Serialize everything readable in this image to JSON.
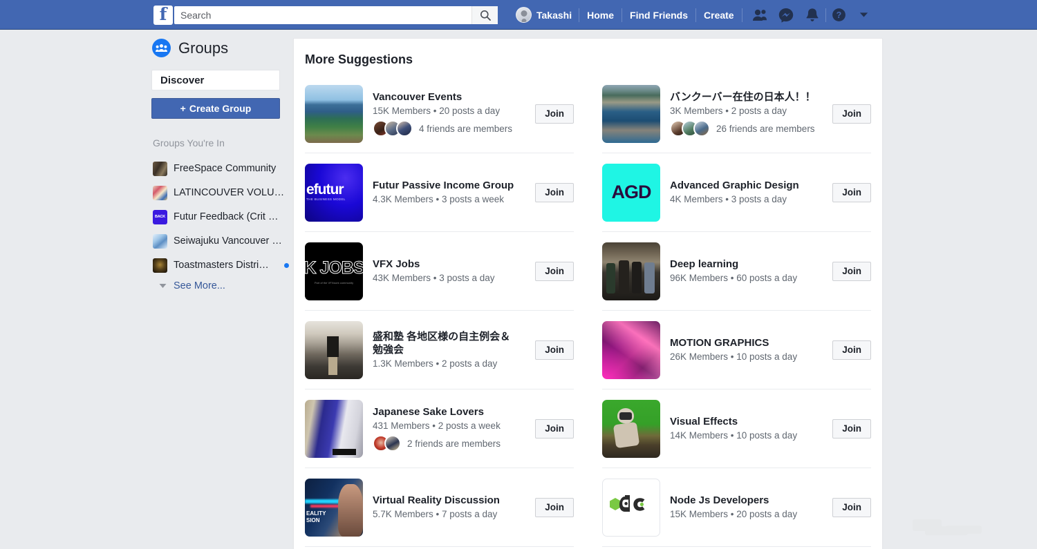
{
  "colors": {
    "header_blue": "#4267b2",
    "page_bg": "#e9ebee",
    "card_bg": "#ffffff",
    "link_blue": "#365899",
    "accent_blue": "#1877f2",
    "muted_text": "#606770",
    "label_gray": "#90949c"
  },
  "header": {
    "logo_text": "f",
    "search": {
      "placeholder": "Search",
      "value": ""
    },
    "user_name": "Takashi",
    "links": [
      "Home",
      "Find Friends",
      "Create"
    ],
    "icons": [
      "friend-requests-icon",
      "messenger-icon",
      "notifications-icon",
      "help-icon",
      "account-menu-caret-icon"
    ]
  },
  "sidebar": {
    "title": "Groups",
    "discover_label": "Discover",
    "create_group_label": "Create Group",
    "create_group_plus": "+",
    "section_label": "Groups You're In",
    "groups": [
      {
        "name": "FreeSpace Community",
        "unread": false
      },
      {
        "name": "LATINCOUVER VOLU…",
        "unread": false
      },
      {
        "name": "Futur Feedback (Crit …",
        "unread": false
      },
      {
        "name": "Seiwajuku Vancouver …",
        "unread": false
      },
      {
        "name": "Toastmasters Distri…",
        "unread": true
      }
    ],
    "see_more_label": "See More..."
  },
  "main": {
    "title": "More Suggestions",
    "join_label": "Join",
    "suggestions": [
      {
        "name": "Vancouver Events",
        "meta": "15K Members • 20 posts a day",
        "friends_text": "4 friends are members",
        "friend_faces": 3,
        "thumb": "vancouver-skyline"
      },
      {
        "name": "バンクーバー在住の日本人！！",
        "meta": "3K Members • 2 posts a day",
        "friends_text": "26 friends are members",
        "friend_faces": 3,
        "thumb": "vancouver-aerial"
      },
      {
        "name": "Futur Passive Income Group",
        "meta": "4.3K Members • 3 posts a week",
        "friends_text": "",
        "friend_faces": 0,
        "thumb": "futur-blue"
      },
      {
        "name": "Advanced Graphic Design",
        "meta": "4K Members • 3 posts a day",
        "friends_text": "",
        "friend_faces": 0,
        "thumb": "agd-cyan"
      },
      {
        "name": "VFX Jobs",
        "meta": "43K Members • 3 posts a day",
        "friends_text": "",
        "friend_faces": 0,
        "thumb": "vfx-jobs-black"
      },
      {
        "name": "Deep learning",
        "meta": "96K Members • 60 posts a day",
        "friends_text": "",
        "friend_faces": 0,
        "thumb": "deep-learning-photo"
      },
      {
        "name": "盛和塾 各地区様の自主例会＆勉強会",
        "meta": "1.3K Members • 2 posts a day",
        "friends_text": "",
        "friend_faces": 0,
        "thumb": "seiwajuku-hall"
      },
      {
        "name": "MOTION GRAPHICS",
        "meta": "26K Members • 10 posts a day",
        "friends_text": "",
        "friend_faces": 0,
        "thumb": "motion-graphics-magenta"
      },
      {
        "name": "Japanese Sake Lovers",
        "meta": "431 Members • 2 posts a week",
        "friends_text": "2 friends are members",
        "friend_faces": 2,
        "thumb": "sake-bottle"
      },
      {
        "name": "Visual Effects",
        "meta": "14K Members • 10 posts a day",
        "friends_text": "",
        "friend_faces": 0,
        "thumb": "vfx-greenscreen"
      },
      {
        "name": "Virtual Reality Discussion",
        "meta": "5.7K Members • 7 posts a day",
        "friends_text": "",
        "friend_faces": 0,
        "thumb": "vr-headset"
      },
      {
        "name": "Node Js Developers",
        "meta": "15K Members • 20 posts a day",
        "friends_text": "",
        "friend_faces": 0,
        "thumb": "node-logo"
      }
    ]
  }
}
